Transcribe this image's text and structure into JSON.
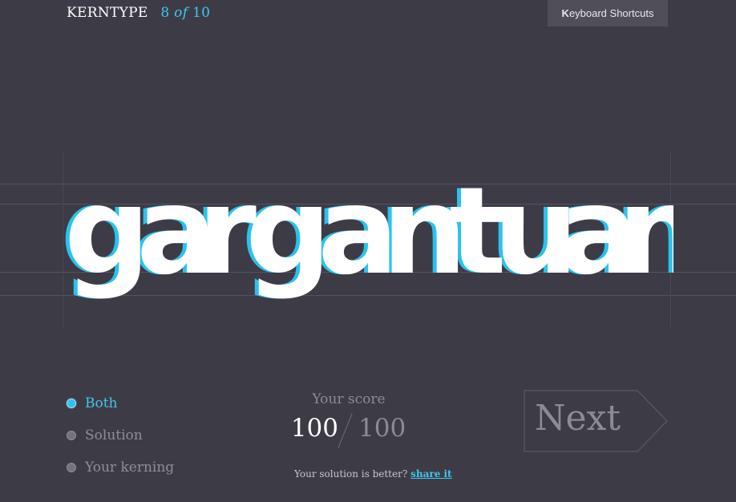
{
  "header": {
    "brand": "KERNTYPE",
    "progress_current": "8",
    "progress_of": "of",
    "progress_total": "10",
    "shortcuts_first": "K",
    "shortcuts_rest": "eyboard Shortcuts"
  },
  "word": {
    "text": "gargantuan",
    "letters": [
      "g",
      "a",
      "r",
      "g",
      "a",
      "n",
      "t",
      "u",
      "a",
      "n"
    ],
    "accent_color": "#29c2ef"
  },
  "view_options": [
    {
      "label": "Both",
      "selected": true
    },
    {
      "label": "Solution",
      "selected": false
    },
    {
      "label": "Your kerning",
      "selected": false
    }
  ],
  "score": {
    "label": "Your score",
    "value": "100",
    "max": "100"
  },
  "note": {
    "text": "Your solution is better?",
    "link": "share it"
  },
  "next": {
    "label": "Next"
  }
}
